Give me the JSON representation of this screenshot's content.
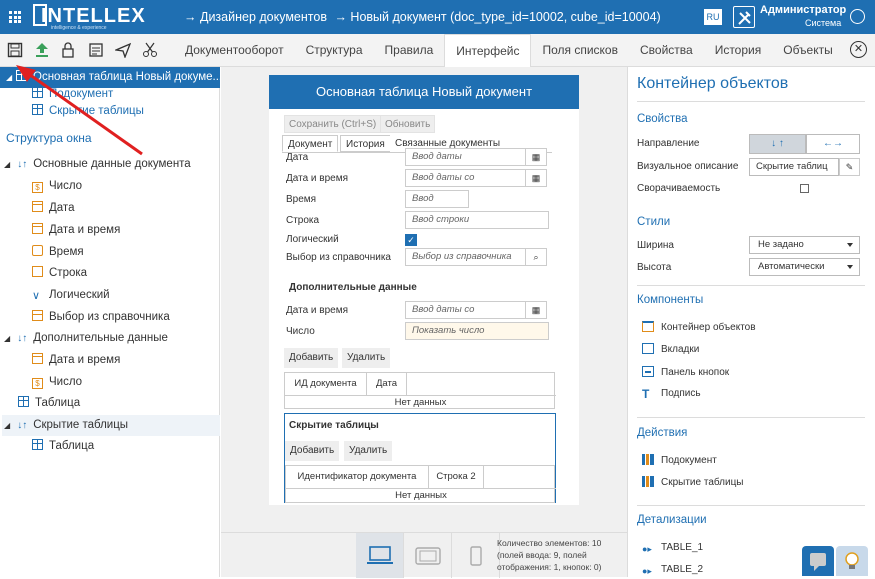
{
  "header": {
    "logo_word": "INTELLEX",
    "logo_tagline": "intelligence & experience",
    "breadcrumb": [
      "→ Дизайнер документов",
      "→ Новый документ (doc_type_id=10002, cube_id=10004)"
    ],
    "language": "RU",
    "user_name": "Администратор",
    "user_role": "Система"
  },
  "tabs": [
    "Документооборот",
    "Структура",
    "Правила",
    "Интерфейс",
    "Поля списков",
    "Свойства",
    "История",
    "Объекты"
  ],
  "active_tab": "Интерфейс",
  "tree": {
    "root": "Основная таблица Новый докуме...",
    "children": [
      "Подокумент",
      "Скрытие таблицы"
    ],
    "section": "Структура окна",
    "nodes": [
      {
        "label": "Основные данные документа",
        "icon": "arrows"
      },
      {
        "label": "Число",
        "icon": "num"
      },
      {
        "label": "Дата",
        "icon": "date"
      },
      {
        "label": "Дата и время",
        "icon": "date"
      },
      {
        "label": "Время",
        "icon": "time"
      },
      {
        "label": "Строка",
        "icon": "str"
      },
      {
        "label": "Логический",
        "icon": "chk"
      },
      {
        "label": "Выбор из справочника",
        "icon": "ref"
      },
      {
        "label": "Дополнительные данные",
        "icon": "arrows"
      },
      {
        "label": "Дата и время",
        "icon": "date"
      },
      {
        "label": "Число",
        "icon": "num"
      },
      {
        "label": "Таблица",
        "icon": "tbl"
      },
      {
        "label": "Скрытие таблицы",
        "icon": "arrows"
      },
      {
        "label": "Таблица",
        "icon": "tbl"
      }
    ]
  },
  "preview": {
    "title": "Основная таблица Новый документ",
    "save_btn": "Сохранить (Ctrl+S)",
    "refresh_btn": "Обновить",
    "tabs": [
      "Документ",
      "История",
      "Связанные документы"
    ],
    "fields": [
      {
        "label": "Дата",
        "placeholder": "Ввод даты"
      },
      {
        "label": "Дата и время",
        "placeholder": "Ввод даты со временем"
      },
      {
        "label": "Время",
        "placeholder": "Ввод времен"
      },
      {
        "label": "Строка",
        "placeholder": "Ввод строки"
      },
      {
        "label": "Логический",
        "placeholder": ""
      },
      {
        "label": "Выбор из справочника",
        "placeholder": "Выбор из справочника"
      }
    ],
    "extra_title": "Дополнительные данные",
    "extra_fields": [
      {
        "label": "Дата и время",
        "placeholder": "Ввод даты со временем"
      },
      {
        "label": "Число",
        "placeholder": "Показать число"
      }
    ],
    "add_btn": "Добавить",
    "delete_btn": "Удалить",
    "table1_cols": [
      "ИД документа",
      "Дата"
    ],
    "no_data": "Нет данных",
    "hide_title": "Скрытие таблицы",
    "table2_cols": [
      "Идентификатор документа",
      "Строка 2"
    ]
  },
  "counts": [
    "Количество элементов: 10",
    "(полей ввода: 9, полей",
    "отображения: 1, кнопок: 0)"
  ],
  "props": {
    "title": "Контейнер объектов",
    "sec_props": "Свойства",
    "direction_label": "Направление",
    "direction_vertical": "↓ ↑",
    "direction_horizontal": "←→",
    "visual_label": "Визуальное описание",
    "visual_value": "Скрытие таблиц",
    "collapse_label": "Сворачиваемость",
    "sec_styles": "Стили",
    "width_label": "Ширина",
    "width_value": "Не задано",
    "height_label": "Высота",
    "height_value": "Автоматически",
    "sec_components": "Компоненты",
    "components": [
      "Контейнер объектов",
      "Вкладки",
      "Панель кнопок",
      "Подпись"
    ],
    "sec_actions": "Действия",
    "actions": [
      "Подокумент",
      "Скрытие таблицы"
    ],
    "sec_details": "Детализации",
    "details": [
      "TABLE_1",
      "TABLE_2"
    ]
  },
  "colors": {
    "primary": "#1f6fb2",
    "accent": "#e08c1a",
    "arrow": "#e02020"
  }
}
